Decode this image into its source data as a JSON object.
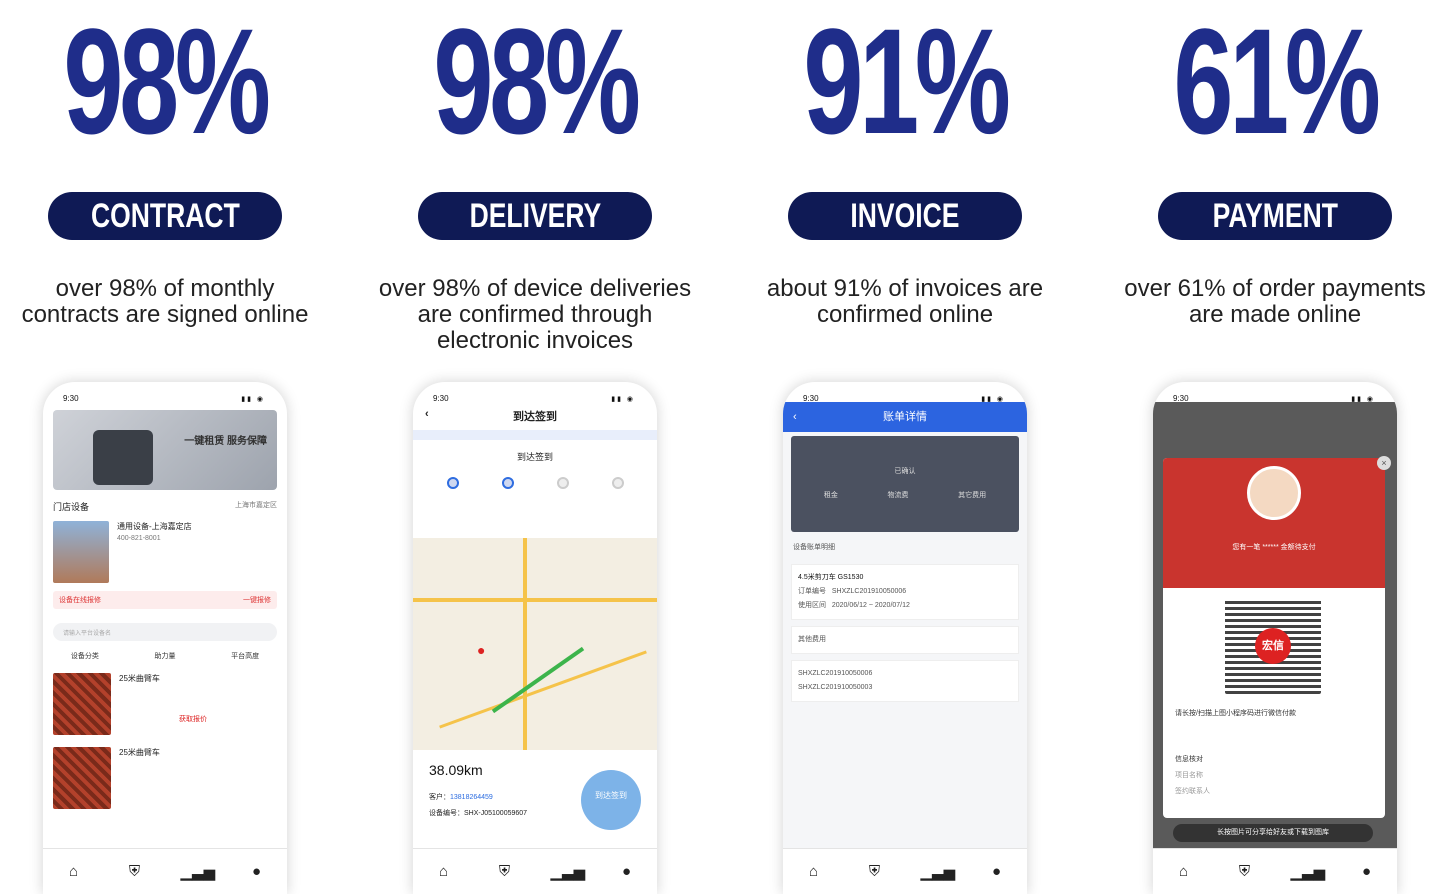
{
  "stats": [
    {
      "percent": "98%",
      "label": "CONTRACT",
      "description_line1": "over 98% of monthly",
      "description_line2": "contracts are signed online",
      "description_line3": ""
    },
    {
      "percent": "98%",
      "label": "DELIVERY",
      "description_line1": "over 98% of device deliveries",
      "description_line2": "are confirmed through",
      "description_line3": "electronic invoices"
    },
    {
      "percent": "91%",
      "label": "INVOICE",
      "description_line1": "about 91% of invoices are",
      "description_line2": "confirmed online",
      "description_line3": ""
    },
    {
      "percent": "61%",
      "label": "PAYMENT",
      "description_line1": "over 61% of order payments",
      "description_line2": "are made online",
      "description_line3": ""
    }
  ],
  "phones": {
    "time": "9:30",
    "nav_icons": [
      "home-icon",
      "shield-icon",
      "chart-icon",
      "user-icon"
    ],
    "phone1": {
      "banner_text": "一键租赁 服务保障",
      "section_title": "门店设备",
      "section_location": "上海市嘉定区",
      "store_name": "通用设备-上海嘉定店",
      "store_phone": "400-821-8001",
      "alert_text": "设备在线报修",
      "alert_button": "一键报修",
      "search_placeholder": "请输入平台设备名",
      "filters": [
        "设备分类",
        "助力量",
        "平台高度"
      ],
      "product1_name": "25米曲臂车",
      "product2_name": "25米曲臂车",
      "quote_button": "获取报价"
    },
    "phone2": {
      "title": "到达签到",
      "subheader": "到达签到",
      "steps": [
        "1",
        "2",
        "3",
        "4"
      ],
      "distance": "38.09km",
      "customer_label": "客户：",
      "customer_phone": "13818264459",
      "device_label": "设备编号：SHX-J05100059607",
      "circle_label": "到达签到"
    },
    "phone3": {
      "title": "账单详情",
      "status": "已确认",
      "cols": [
        "租金",
        "物流费",
        "其它费用"
      ],
      "section": "设备账单明细",
      "device": "4.5米剪刀车 GS1530",
      "order_label": "订单编号",
      "order_no": "SHXZLC201910050006",
      "date_label": "使用区间",
      "date_start": "2020/06/12",
      "date_end": "2020/07/12",
      "other_fee": "其他费用",
      "order_no2": "SHXZLC201910050006",
      "order_no3": "SHXZLC201910050003"
    },
    "phone4": {
      "pay_prompt": "您有一笔",
      "pay_suffix": "金额待支付",
      "qr_badge": "宏信",
      "instructions": "请长按/扫描上图小程序码进行微信付款",
      "info_title": "信息核对",
      "info_items": [
        "项目名称",
        "签约联系人"
      ],
      "download_button": "长按图片可分享给好友或下载到图库"
    }
  }
}
